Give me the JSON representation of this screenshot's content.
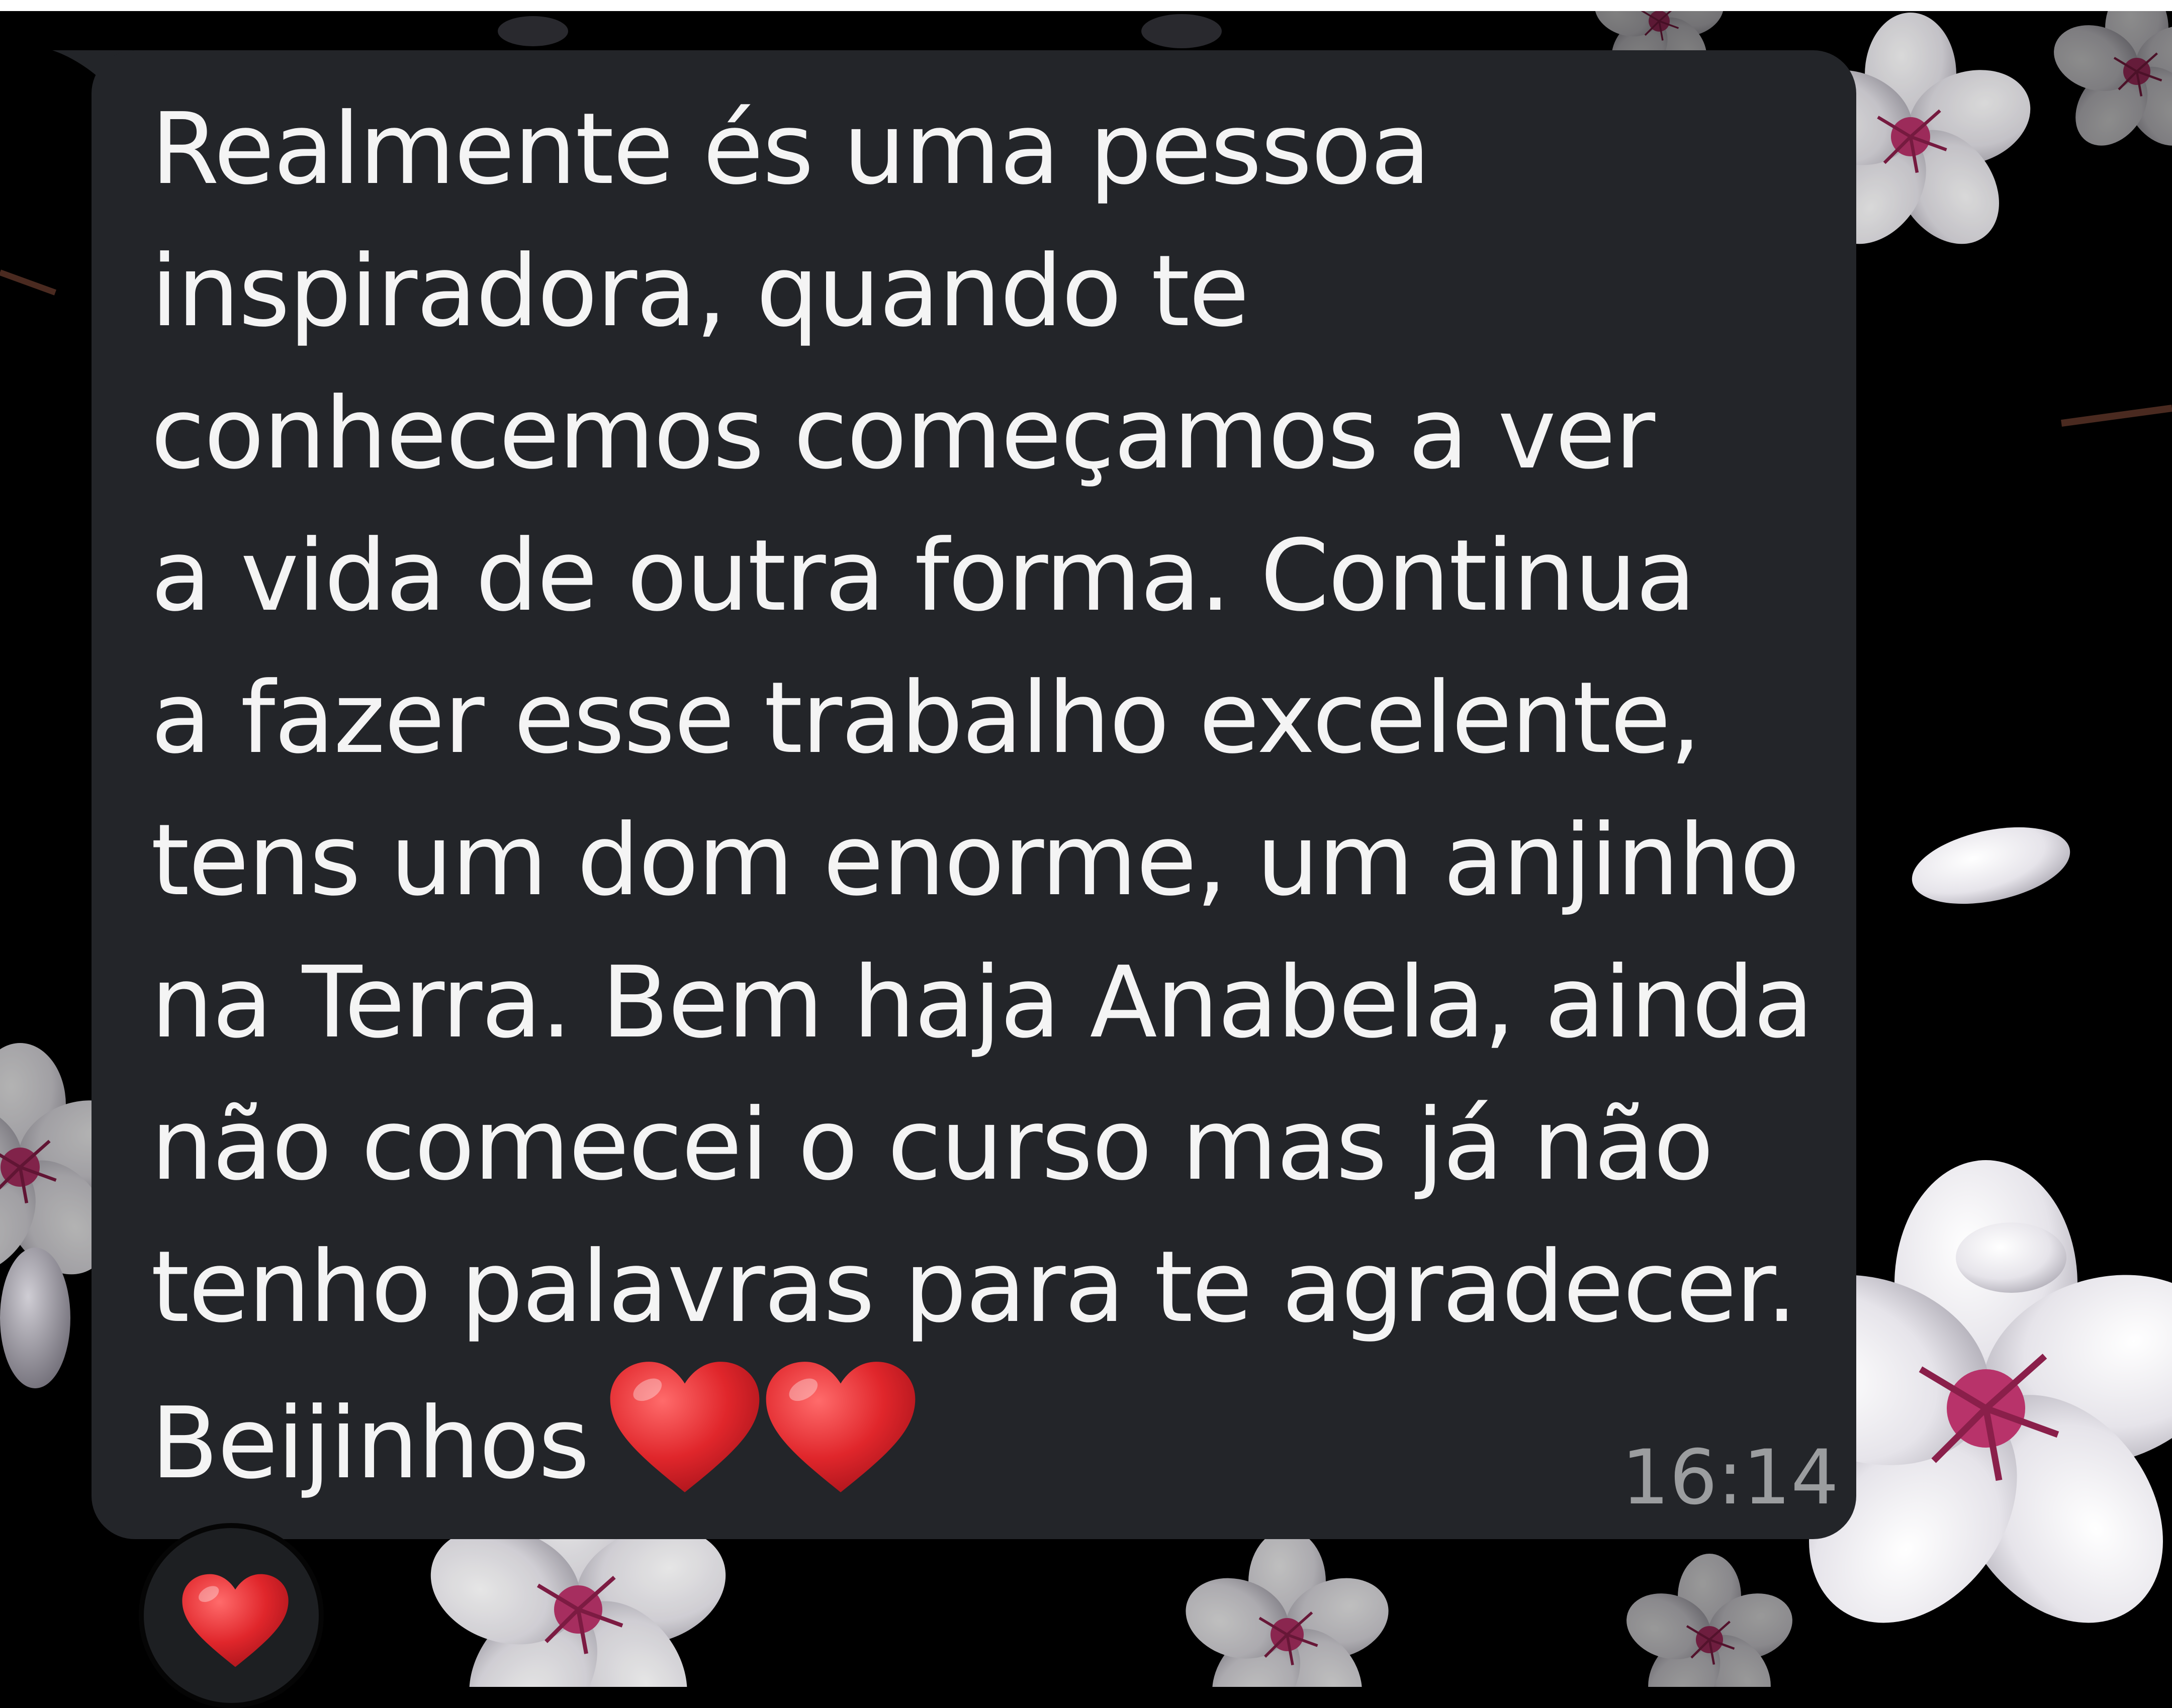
{
  "message": {
    "lines": [
      "Realmente és uma pessoa",
      "inspiradora, quando te",
      "conhecemos começamos a ver",
      "a vida de outra forma. Continua",
      "a fazer esse trabalho excelente,",
      "tens um dom enorme, um anjinho",
      "na Terra. Bem haja Anabela, ainda",
      "não comecei o curso mas já não",
      "tenho palavras para te agradecer.",
      "Beijinhos"
    ],
    "time": "16:14",
    "emoji_count": 2
  },
  "reaction": {
    "icon": "red-heart-icon",
    "count": 1
  },
  "colors": {
    "background": "#000000",
    "bubble": "#232529",
    "text": "#f4f4f4",
    "time": "#9b9d9f",
    "heart": "#e0262b",
    "petal": "#e9e8ec"
  }
}
